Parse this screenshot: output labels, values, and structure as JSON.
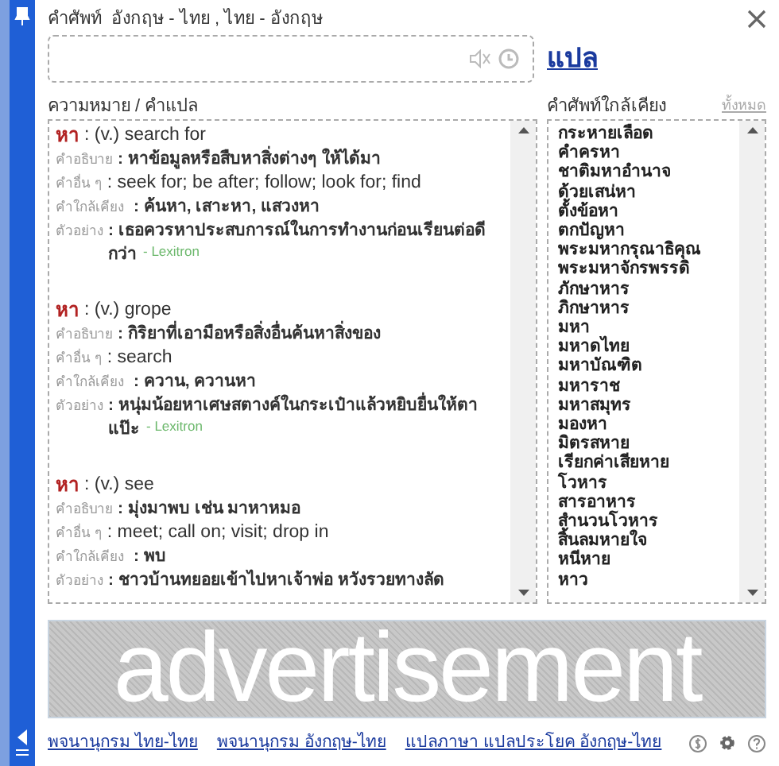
{
  "window": {
    "title": "คำศัพท์  อังกฤษ - ไทย , ไทย - อังกฤษ"
  },
  "search": {
    "translate_link": "แปล"
  },
  "meanings": {
    "heading": "ความหมาย / คำแปล",
    "entries": [
      {
        "word": "หา",
        "gloss": ": (v.) search for",
        "fields": [
          {
            "label": "คำอธิบาย",
            "value": ": หาข้อมูลหรือสืบหาสิ่งต่างๆ ให้ได้มา",
            "kind": "thai"
          },
          {
            "label": "คำอื่น ๆ",
            "value": ": seek for; be after; follow; look for; find",
            "kind": "english"
          },
          {
            "label": "คำใกล้เคียง",
            "value": ": ค้นหา, เสาะหา, แสวงหา",
            "kind": "thai"
          },
          {
            "label": "ตัวอย่าง",
            "value": ": เธอควรหาประสบการณ์ในการทำงานก่อนเรียนต่อดีกว่า",
            "kind": "thai"
          }
        ],
        "source": "- Lexitron"
      },
      {
        "word": "หา",
        "gloss": ": (v.) grope",
        "fields": [
          {
            "label": "คำอธิบาย",
            "value": ": กิริยาที่เอามือหรือสิ่งอื่นค้นหาสิ่งของ",
            "kind": "thai"
          },
          {
            "label": "คำอื่น ๆ",
            "value": ": search",
            "kind": "english"
          },
          {
            "label": "คำใกล้เคียง",
            "value": ": ควาน, ควานหา",
            "kind": "thai"
          },
          {
            "label": "ตัวอย่าง",
            "value": ": หนุ่มน้อยหาเศษสตางค์ในกระเป๋าแล้วหยิบยื่นให้ตาแป๊ะ",
            "kind": "thai"
          }
        ],
        "source": "- Lexitron"
      },
      {
        "word": "หา",
        "gloss": ": (v.) see",
        "fields": [
          {
            "label": "คำอธิบาย",
            "value": ": มุ่งมาพบ เช่น มาหาหมอ",
            "kind": "thai"
          },
          {
            "label": "คำอื่น ๆ",
            "value": ": meet; call on; visit; drop in",
            "kind": "english"
          },
          {
            "label": "คำใกล้เคียง",
            "value": ": พบ",
            "kind": "thai"
          },
          {
            "label": "ตัวอย่าง",
            "value": ": ชาวบ้านทยอยเข้าไปหาเจ้าพ่อ หวังรวยทางลัด",
            "kind": "thai"
          }
        ]
      }
    ]
  },
  "related": {
    "heading": "คำศัพท์ใกล้เคียง",
    "all_link": "ทั้งหมด",
    "items": [
      "กระหายเลือด",
      "คำครหา",
      "ชาติมหาอำนาจ",
      "ด้วยเสน่หา",
      "ตั้งข้อหา",
      "ตกปัญหา",
      "พระมหากรุณาธิคุณ",
      "พระมหาจักรพรรดิ",
      "ภักษาหาร",
      "ภิกษาหาร",
      "มหา",
      "มหาดไทย",
      "มหาบัณฑิต",
      "มหาราช",
      "มหาสมุทร",
      "มองหา",
      "มิตรสหาย",
      "เรียกค่าเสียหาย",
      "โวหาร",
      "สารอาหาร",
      "สำนวนโวหาร",
      "สิ้นลมหายใจ",
      "หนีหาย",
      "หาว"
    ]
  },
  "ad": {
    "text": "advertisement"
  },
  "footer": {
    "links": [
      "พจนานุกรม ไทย-ไทย",
      "พจนานุกรม อังกฤษ-ไทย",
      "แปลภาษา แปลประโยค อังกฤษ-ไทย"
    ]
  }
}
